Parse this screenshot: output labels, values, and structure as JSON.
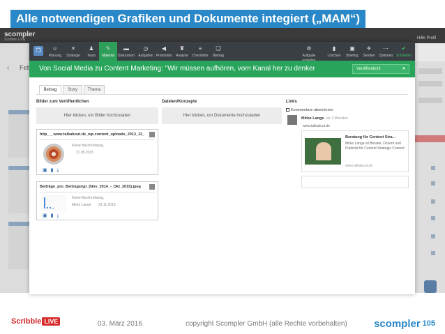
{
  "slide": {
    "title": "Alle notwendigen Grafiken und Dokumente integiert („MAM“)",
    "footer_date": "03. März 2016",
    "footer_copy": "copyright Scompler GmbH (alle Rechte vorbehalten)",
    "page_number": "105",
    "brand": "scompler",
    "logo_left": "Scribble",
    "logo_live": "LIVE"
  },
  "background_app": {
    "logo": "scompler",
    "logo_sub": "Scribble LIVE",
    "back_title": "Febr",
    "right_top": "Hilfe  Profil"
  },
  "toolbar": {
    "items": [
      {
        "label": "Planung",
        "icon": "smiley-icon"
      },
      {
        "label": "Strategie",
        "icon": "tools-icon"
      },
      {
        "label": "Team",
        "icon": "team-icon"
      },
      {
        "label": "Material",
        "icon": "pen-icon"
      },
      {
        "label": "Diskussion",
        "icon": "chat-icon"
      },
      {
        "label": "Aufgaben",
        "icon": "clock-icon"
      },
      {
        "label": "Promotion",
        "icon": "megaphone-icon"
      },
      {
        "label": "Analyse",
        "icon": "trophy-icon"
      },
      {
        "label": "Checkliste",
        "icon": "list-icon"
      },
      {
        "label": "Beitrag",
        "icon": "copy-icon"
      }
    ],
    "right_items": [
      {
        "label": "Aufgabe erstellen",
        "icon": "gear-icon"
      },
      {
        "label": "Löschen",
        "icon": "trash-icon"
      },
      {
        "label": "Briefing",
        "icon": "briefcase-icon"
      },
      {
        "label": "Senden",
        "icon": "send-icon"
      },
      {
        "label": "Optionen",
        "icon": "more-icon"
      },
      {
        "label": "Schließen",
        "icon": "check-icon"
      }
    ]
  },
  "doc": {
    "title": "Von Social Media zu Content Marketing: \"Wir müssen aufhören, vom Kanal her zu denker",
    "status": "Veröffentlicht"
  },
  "tabs": [
    "Beitrag",
    "Story",
    "Thema"
  ],
  "sections": {
    "images_label": "Bilder zum Veröffentlichen",
    "images_upload": "Hier klicken, um Bilder hochzuladen",
    "files_label": "Dateien/Konzepte",
    "files_upload": "Hier klicken, um Dokumente hochzuladen",
    "links_label": "Links"
  },
  "images": [
    {
      "filename": "http___www.talkabout.de_wp-content_uploads_2013_12_...",
      "desc": "Keine Beschreibung,",
      "author": "",
      "date": "31.05.2015"
    },
    {
      "filename": "Beiträge_pro_Beitragstyp_(Nov_2014_-_Okt_2015).jpeg",
      "desc": "Keine Beschreibung,",
      "author": "Mirko Lange",
      "date": "23.11.2015"
    }
  ],
  "links": {
    "checkbox": "Kommentare abonnieren",
    "author": "Mirko Lange",
    "ago": "vor 3 Monaten",
    "url": "www.talkabout.de",
    "preview_title": "Beratung für Content Stra...",
    "preview_desc": "Mirko Lange ist Berater, Dozent und Publizist für Content Strategic Content",
    "preview_src": "www.talkabout.de"
  }
}
